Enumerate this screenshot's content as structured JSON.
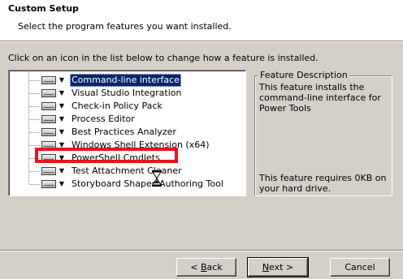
{
  "header": {
    "title": "Custom Setup",
    "subtitle": "Select the program features you want installed."
  },
  "instruction": "Click on an icon in the list below to change how a feature is installed.",
  "features": [
    {
      "label": "Command-line interface",
      "selected": true
    },
    {
      "label": "Visual Studio Integration",
      "selected": false
    },
    {
      "label": "Check-in Policy Pack",
      "selected": false
    },
    {
      "label": "Process Editor",
      "selected": false
    },
    {
      "label": "Best Practices Analyzer",
      "selected": false
    },
    {
      "label": "Windows Shell Extension (x64)",
      "selected": false
    },
    {
      "label": "PowerShell Cmdlets",
      "selected": false
    },
    {
      "label": "Test Attachment Cleaner",
      "selected": false
    },
    {
      "label": "Storyboard Shapes Authoring Tool",
      "selected": false
    }
  ],
  "feature_description": {
    "legend": "Feature Description",
    "text": "This feature installs the command-line interface for Power Tools",
    "size_text": "This feature requires 0KB on your hard drive."
  },
  "buttons": {
    "back": {
      "pre": "< ",
      "accel": "B",
      "post": "ack"
    },
    "next": {
      "pre": "",
      "accel": "N",
      "post": "ext >"
    },
    "cancel": {
      "label": "Cancel"
    }
  },
  "colors": {
    "highlight_box": "#e8141e",
    "selection": "#0a246a",
    "dialog_bg": "#d4d0c8"
  }
}
